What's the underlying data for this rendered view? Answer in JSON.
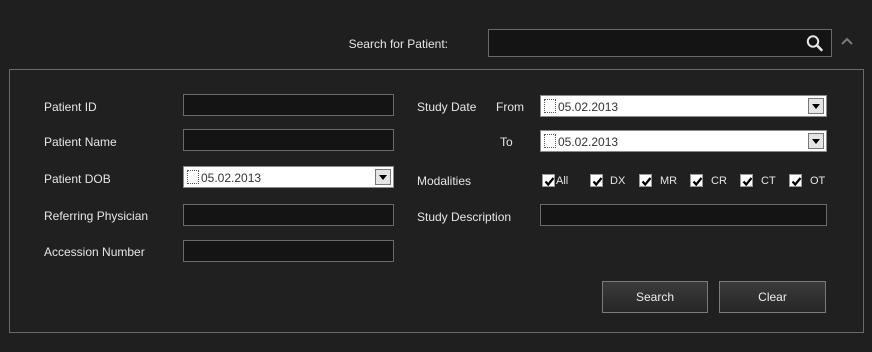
{
  "header": {
    "search_label": "Search for Patient:",
    "search_value": "",
    "search_icon": "magnifier-icon",
    "collapse_icon": "chevron-up-icon"
  },
  "form": {
    "patient_id_label": "Patient ID",
    "patient_id_value": "",
    "patient_name_label": "Patient Name",
    "patient_name_value": "",
    "patient_dob_label": "Patient DOB",
    "patient_dob_value": "05.02.2013",
    "referring_physician_label": "Referring Physician",
    "referring_physician_value": "",
    "accession_number_label": "Accession Number",
    "accession_number_value": "",
    "study_date_label": "Study Date",
    "from_label": "From",
    "from_value": "05.02.2013",
    "to_label": "To",
    "to_value": "05.02.2013",
    "modalities_label": "Modalities",
    "modalities": [
      {
        "label": "All",
        "checked": true
      },
      {
        "label": "DX",
        "checked": true
      },
      {
        "label": "MR",
        "checked": true
      },
      {
        "label": "CR",
        "checked": true
      },
      {
        "label": "CT",
        "checked": true
      },
      {
        "label": "OT",
        "checked": true
      }
    ],
    "study_description_label": "Study Description",
    "study_description_value": ""
  },
  "buttons": {
    "search": "Search",
    "clear": "Clear"
  },
  "colors": {
    "background": "#1f1f1f",
    "field_bg": "#141414",
    "border": "#6a6a6a"
  }
}
